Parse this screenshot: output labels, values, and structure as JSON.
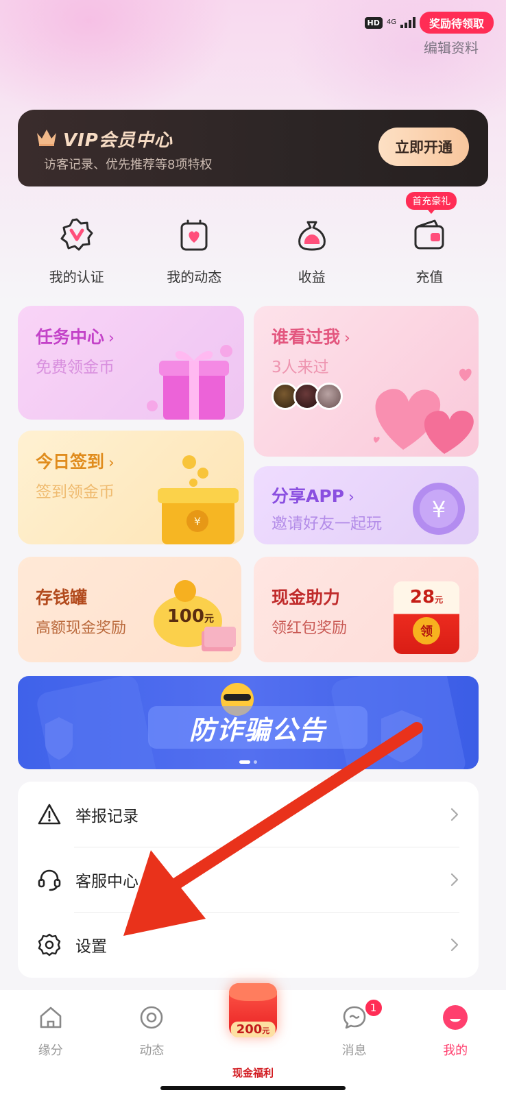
{
  "status_bar": {
    "hd": "HD",
    "network": "4G",
    "reward_pill": "奖励待领取"
  },
  "header": {
    "edit_profile": "编辑资料"
  },
  "vip": {
    "title": "VIP会员中心",
    "subtitle": "访客记录、优先推荐等8项特权",
    "button": "立即开通"
  },
  "quick_actions": [
    {
      "label": "我的认证",
      "icon": "verify-badge-icon"
    },
    {
      "label": "我的动态",
      "icon": "heart-bag-icon"
    },
    {
      "label": "收益",
      "icon": "money-bag-icon"
    },
    {
      "label": "充值",
      "icon": "wallet-icon",
      "badge": "首充豪礼"
    }
  ],
  "cards": {
    "task": {
      "title": "任务中心",
      "subtitle": "免费领金币"
    },
    "visitors": {
      "title": "谁看过我",
      "subtitle": "3人来过"
    },
    "signin": {
      "title": "今日签到",
      "subtitle": "签到领金币"
    },
    "share": {
      "title": "分享APP",
      "subtitle": "邀请好友一起玩"
    },
    "piggy": {
      "title": "存钱罐",
      "subtitle": "高额现金奖励",
      "amount": "100",
      "unit": "元"
    },
    "cash": {
      "title": "现金助力",
      "subtitle": "领红包奖励",
      "amount": "28",
      "unit": "元",
      "action": "领"
    }
  },
  "banner": {
    "text": "防诈骗公告"
  },
  "menu": [
    {
      "label": "举报记录",
      "icon": "warning-icon"
    },
    {
      "label": "客服中心",
      "icon": "headset-icon"
    },
    {
      "label": "设置",
      "icon": "gear-icon"
    }
  ],
  "tabbar": {
    "tabs": [
      {
        "label": "缘分",
        "icon": "home-icon"
      },
      {
        "label": "动态",
        "icon": "circle-icon"
      },
      {
        "label": "现金福利",
        "amount": "200",
        "unit": "元"
      },
      {
        "label": "消息",
        "icon": "chat-icon",
        "badge": "1"
      },
      {
        "label": "我的",
        "icon": "profile-icon"
      }
    ]
  },
  "colors": {
    "accent": "#ff2d55",
    "vip_bg": "#2c2525",
    "banner": "#4a68ee"
  }
}
